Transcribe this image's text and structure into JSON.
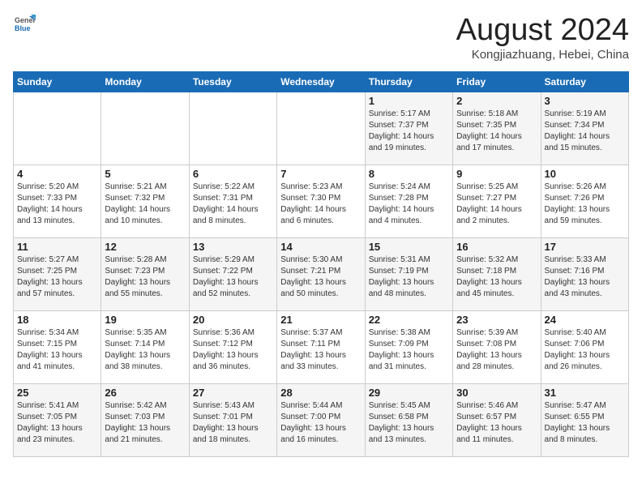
{
  "header": {
    "logo_general": "General",
    "logo_blue": "Blue",
    "month_year": "August 2024",
    "location": "Kongjiazhuang, Hebei, China"
  },
  "weekdays": [
    "Sunday",
    "Monday",
    "Tuesday",
    "Wednesday",
    "Thursday",
    "Friday",
    "Saturday"
  ],
  "weeks": [
    [
      {
        "day": "",
        "content": ""
      },
      {
        "day": "",
        "content": ""
      },
      {
        "day": "",
        "content": ""
      },
      {
        "day": "",
        "content": ""
      },
      {
        "day": "1",
        "content": "Sunrise: 5:17 AM\nSunset: 7:37 PM\nDaylight: 14 hours\nand 19 minutes."
      },
      {
        "day": "2",
        "content": "Sunrise: 5:18 AM\nSunset: 7:35 PM\nDaylight: 14 hours\nand 17 minutes."
      },
      {
        "day": "3",
        "content": "Sunrise: 5:19 AM\nSunset: 7:34 PM\nDaylight: 14 hours\nand 15 minutes."
      }
    ],
    [
      {
        "day": "4",
        "content": "Sunrise: 5:20 AM\nSunset: 7:33 PM\nDaylight: 14 hours\nand 13 minutes."
      },
      {
        "day": "5",
        "content": "Sunrise: 5:21 AM\nSunset: 7:32 PM\nDaylight: 14 hours\nand 10 minutes."
      },
      {
        "day": "6",
        "content": "Sunrise: 5:22 AM\nSunset: 7:31 PM\nDaylight: 14 hours\nand 8 minutes."
      },
      {
        "day": "7",
        "content": "Sunrise: 5:23 AM\nSunset: 7:30 PM\nDaylight: 14 hours\nand 6 minutes."
      },
      {
        "day": "8",
        "content": "Sunrise: 5:24 AM\nSunset: 7:28 PM\nDaylight: 14 hours\nand 4 minutes."
      },
      {
        "day": "9",
        "content": "Sunrise: 5:25 AM\nSunset: 7:27 PM\nDaylight: 14 hours\nand 2 minutes."
      },
      {
        "day": "10",
        "content": "Sunrise: 5:26 AM\nSunset: 7:26 PM\nDaylight: 13 hours\nand 59 minutes."
      }
    ],
    [
      {
        "day": "11",
        "content": "Sunrise: 5:27 AM\nSunset: 7:25 PM\nDaylight: 13 hours\nand 57 minutes."
      },
      {
        "day": "12",
        "content": "Sunrise: 5:28 AM\nSunset: 7:23 PM\nDaylight: 13 hours\nand 55 minutes."
      },
      {
        "day": "13",
        "content": "Sunrise: 5:29 AM\nSunset: 7:22 PM\nDaylight: 13 hours\nand 52 minutes."
      },
      {
        "day": "14",
        "content": "Sunrise: 5:30 AM\nSunset: 7:21 PM\nDaylight: 13 hours\nand 50 minutes."
      },
      {
        "day": "15",
        "content": "Sunrise: 5:31 AM\nSunset: 7:19 PM\nDaylight: 13 hours\nand 48 minutes."
      },
      {
        "day": "16",
        "content": "Sunrise: 5:32 AM\nSunset: 7:18 PM\nDaylight: 13 hours\nand 45 minutes."
      },
      {
        "day": "17",
        "content": "Sunrise: 5:33 AM\nSunset: 7:16 PM\nDaylight: 13 hours\nand 43 minutes."
      }
    ],
    [
      {
        "day": "18",
        "content": "Sunrise: 5:34 AM\nSunset: 7:15 PM\nDaylight: 13 hours\nand 41 minutes."
      },
      {
        "day": "19",
        "content": "Sunrise: 5:35 AM\nSunset: 7:14 PM\nDaylight: 13 hours\nand 38 minutes."
      },
      {
        "day": "20",
        "content": "Sunrise: 5:36 AM\nSunset: 7:12 PM\nDaylight: 13 hours\nand 36 minutes."
      },
      {
        "day": "21",
        "content": "Sunrise: 5:37 AM\nSunset: 7:11 PM\nDaylight: 13 hours\nand 33 minutes."
      },
      {
        "day": "22",
        "content": "Sunrise: 5:38 AM\nSunset: 7:09 PM\nDaylight: 13 hours\nand 31 minutes."
      },
      {
        "day": "23",
        "content": "Sunrise: 5:39 AM\nSunset: 7:08 PM\nDaylight: 13 hours\nand 28 minutes."
      },
      {
        "day": "24",
        "content": "Sunrise: 5:40 AM\nSunset: 7:06 PM\nDaylight: 13 hours\nand 26 minutes."
      }
    ],
    [
      {
        "day": "25",
        "content": "Sunrise: 5:41 AM\nSunset: 7:05 PM\nDaylight: 13 hours\nand 23 minutes."
      },
      {
        "day": "26",
        "content": "Sunrise: 5:42 AM\nSunset: 7:03 PM\nDaylight: 13 hours\nand 21 minutes."
      },
      {
        "day": "27",
        "content": "Sunrise: 5:43 AM\nSunset: 7:01 PM\nDaylight: 13 hours\nand 18 minutes."
      },
      {
        "day": "28",
        "content": "Sunrise: 5:44 AM\nSunset: 7:00 PM\nDaylight: 13 hours\nand 16 minutes."
      },
      {
        "day": "29",
        "content": "Sunrise: 5:45 AM\nSunset: 6:58 PM\nDaylight: 13 hours\nand 13 minutes."
      },
      {
        "day": "30",
        "content": "Sunrise: 5:46 AM\nSunset: 6:57 PM\nDaylight: 13 hours\nand 11 minutes."
      },
      {
        "day": "31",
        "content": "Sunrise: 5:47 AM\nSunset: 6:55 PM\nDaylight: 13 hours\nand 8 minutes."
      }
    ]
  ]
}
